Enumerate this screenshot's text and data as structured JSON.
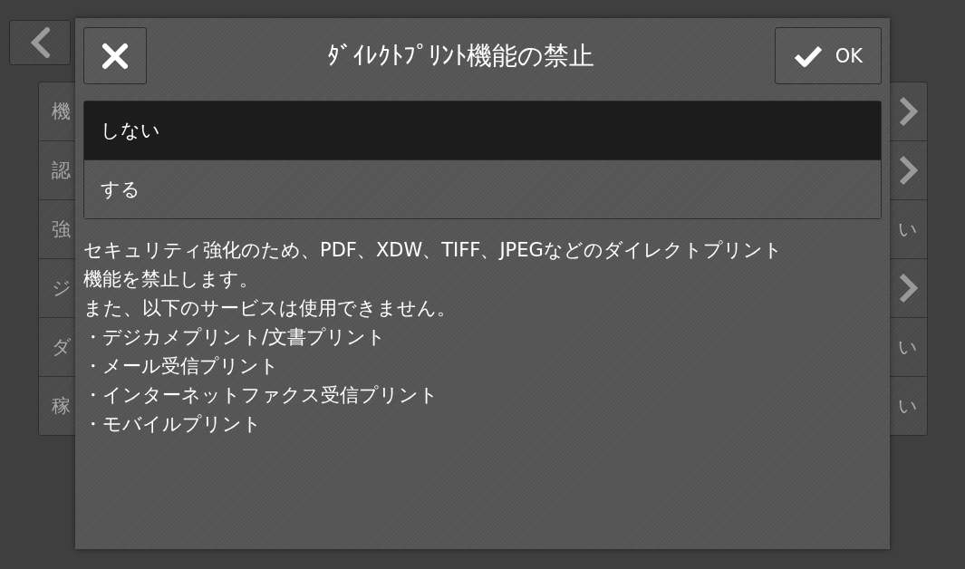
{
  "background_list": {
    "rows": [
      {
        "label": "機",
        "kind": "chevron"
      },
      {
        "label": "認",
        "kind": "chevron"
      },
      {
        "label": "強",
        "kind": "text",
        "trailing": "い"
      },
      {
        "label": "ジ",
        "kind": "chevron"
      },
      {
        "label": "ダ",
        "kind": "text",
        "trailing": "い"
      },
      {
        "label": "稼",
        "kind": "text",
        "trailing": "い"
      }
    ]
  },
  "dialog": {
    "title": "ﾀﾞｲﾚｸﾄﾌﾟﾘﾝﾄ機能の禁止",
    "ok_label": "OK",
    "options": [
      {
        "label": "しない",
        "selected": true
      },
      {
        "label": "する",
        "selected": false
      }
    ],
    "description": [
      "セキュリティ強化のため、PDF、XDW、TIFF、JPEGなどのダイレクトプリント機能を禁止します。",
      "また、以下のサービスは使用できません。"
    ],
    "services": [
      "・デジカメプリント/文書プリント",
      "・メール受信プリント",
      "・インターネットファクス受信プリント",
      "・モバイルプリント"
    ]
  }
}
